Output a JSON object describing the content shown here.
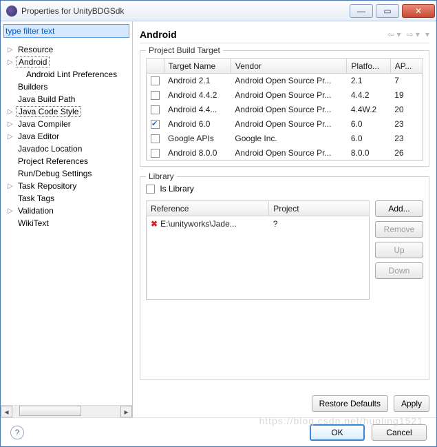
{
  "window": {
    "title": "Properties for UnityBDGSdk"
  },
  "filter": {
    "placeholder": "type filter text"
  },
  "tree": [
    {
      "label": "Resource",
      "exp": true
    },
    {
      "label": "Android",
      "exp": true,
      "sel": true
    },
    {
      "label": "Android Lint Preferences",
      "indent": true
    },
    {
      "label": "Builders"
    },
    {
      "label": "Java Build Path"
    },
    {
      "label": "Java Code Style",
      "exp": true,
      "sel": true
    },
    {
      "label": "Java Compiler",
      "exp": true
    },
    {
      "label": "Java Editor",
      "exp": true
    },
    {
      "label": "Javadoc Location"
    },
    {
      "label": "Project References"
    },
    {
      "label": "Run/Debug Settings"
    },
    {
      "label": "Task Repository",
      "exp": true
    },
    {
      "label": "Task Tags"
    },
    {
      "label": "Validation",
      "exp": true
    },
    {
      "label": "WikiText"
    }
  ],
  "page": {
    "title": "Android",
    "group1": "Project Build Target",
    "cols": [
      "Target Name",
      "Vendor",
      "Platfo...",
      "AP..."
    ],
    "rows": [
      {
        "c": false,
        "n": "Android 2.1",
        "v": "Android Open Source Pr...",
        "p": "2.1",
        "a": "7"
      },
      {
        "c": false,
        "n": "Android 4.4.2",
        "v": "Android Open Source Pr...",
        "p": "4.4.2",
        "a": "19"
      },
      {
        "c": false,
        "n": "Android 4.4...",
        "v": "Android Open Source Pr...",
        "p": "4.4W.2",
        "a": "20"
      },
      {
        "c": true,
        "n": "Android 6.0",
        "v": "Android Open Source Pr...",
        "p": "6.0",
        "a": "23"
      },
      {
        "c": false,
        "n": "Google APIs",
        "v": "Google Inc.",
        "p": "6.0",
        "a": "23"
      },
      {
        "c": false,
        "n": "Android 8.0.0",
        "v": "Android Open Source Pr...",
        "p": "8.0.0",
        "a": "26"
      }
    ],
    "group2": "Library",
    "islib": "Is Library",
    "libcols": [
      "Reference",
      "Project"
    ],
    "librow": {
      "ref": "E:\\unityworks\\Jade...",
      "proj": "?"
    },
    "btns": {
      "add": "Add...",
      "remove": "Remove",
      "up": "Up",
      "down": "Down",
      "restore": "Restore Defaults",
      "apply": "Apply",
      "ok": "OK",
      "cancel": "Cancel"
    }
  },
  "watermark": "https://blog.csdn.net/huoling1521"
}
